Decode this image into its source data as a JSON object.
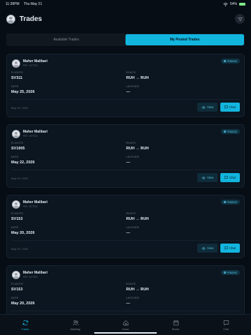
{
  "status_bar": {
    "time": "11:39PM",
    "date": "Thu May 21",
    "battery": "54%"
  },
  "header": {
    "title": "Trades"
  },
  "tabs": [
    {
      "label": "Available Trades",
      "active": false
    },
    {
      "label": "My Posted Trades",
      "active": true
    }
  ],
  "field_labels": {
    "flights": "FLIGHTS",
    "route": "ROUTE",
    "date": "DATE",
    "layover": "LAYOVER"
  },
  "buttons": {
    "view": "View",
    "chat": "Chat"
  },
  "trades": [
    {
      "name": "Maher Malibari",
      "id": "PER. 1577523",
      "status": "PENDING",
      "flights": "SV311",
      "route": "RUH → RUH",
      "date": "May 25, 2026",
      "layover": "—",
      "posted": "May 19, 2026"
    },
    {
      "name": "Maher Malibari",
      "id": "PER. 1577523",
      "status": "PENDING",
      "flights": "SV1905",
      "route": "RUH → RUH",
      "date": "May 22, 2026",
      "layover": "—",
      "posted": "May 19, 2026"
    },
    {
      "name": "Maher Malibari",
      "id": "PER. 1577523",
      "status": "PENDING",
      "flights": "SV153",
      "route": "RUH → RUH",
      "date": "May 20, 2026",
      "layover": "—",
      "posted": "May 19, 2026"
    },
    {
      "name": "Maher Malibari",
      "id": "PER. 1577523",
      "status": "PENDING",
      "flights": "SV153",
      "route": "RUH → RUH",
      "date": "May 20, 2026",
      "layover": "—",
      "posted": "May 19, 2026"
    }
  ],
  "nav": [
    {
      "label": "Trades",
      "icon": "refresh-icon",
      "active": true
    },
    {
      "label": "Matching",
      "icon": "users-icon",
      "active": false
    },
    {
      "label": "Home",
      "icon": "home-icon",
      "active": false
    },
    {
      "label": "Roster",
      "icon": "calendar-icon",
      "active": false
    },
    {
      "label": "Chat",
      "icon": "chat-icon",
      "active": false
    }
  ],
  "colors": {
    "accent": "#12b5de",
    "background": "#070d14",
    "card": "#0c1620",
    "badge_bg": "#0f3444"
  }
}
